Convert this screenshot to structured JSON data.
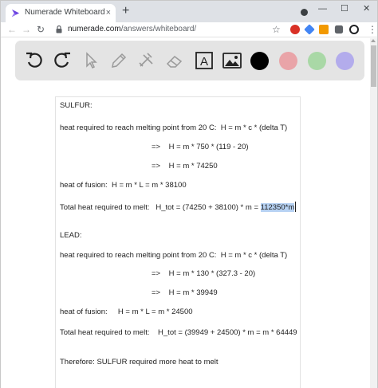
{
  "browser": {
    "tab_title": "Numerade Whiteboard",
    "tab_close": "×",
    "new_tab": "+",
    "window_controls": {
      "minimize": "—",
      "maximize": "☐",
      "close": "✕"
    },
    "nav": {
      "back": "←",
      "forward": "→",
      "reload": "↻"
    },
    "url_domain": "numerade.com",
    "url_path": "/answers/whiteboard/",
    "star": "☆",
    "menu": "⋮",
    "extensions": [
      {
        "name": "extension-red-icon",
        "color": "#d93025"
      },
      {
        "name": "extension-blue-icon",
        "color": "#4285f4"
      },
      {
        "name": "extension-orange-icon",
        "color": "#f29900"
      },
      {
        "name": "extension-puzzle-icon",
        "color": "#5f6368"
      },
      {
        "name": "profile-soccer-icon",
        "color": "#202124"
      }
    ]
  },
  "whiteboard": {
    "tools": [
      "undo-icon",
      "redo-icon",
      "pointer-icon",
      "pencil-icon",
      "tools-icon",
      "eraser-icon",
      "text-tool-icon",
      "image-icon"
    ],
    "text_tool_glyph": "A",
    "swatches": [
      "#000000",
      "#e9a4a8",
      "#a9d8a6",
      "#b3acec"
    ],
    "lines": {
      "l1": "SULFUR:",
      "l2": "heat required to reach melting point from 20 C:  H = m * c * (delta T)",
      "l3": "=>    H = m * 750 * (119 - 20)",
      "l4": "=>    H = m * 74250",
      "l5": "heat of fusion:  H = m * L = m * 38100",
      "l6_prefix": "Total heat required to melt:   H_tot = (74250 + 38100) * m = ",
      "l6_highlight": "112350*m",
      "l7": "LEAD:",
      "l8": "heat required to reach melting point from 20 C:  H = m * c * (delta T)",
      "l9": "=>    H = m * 130 * (327.3 - 20)",
      "l10": "=>    H = m * 39949",
      "l11": "heat of fusion:     H = m * L = m * 24500",
      "l12": "Total heat required to melt:    H_tot = (39949 + 24500) * m = m * 64449",
      "l13": "Therefore: SULFUR required more heat to melt"
    }
  }
}
